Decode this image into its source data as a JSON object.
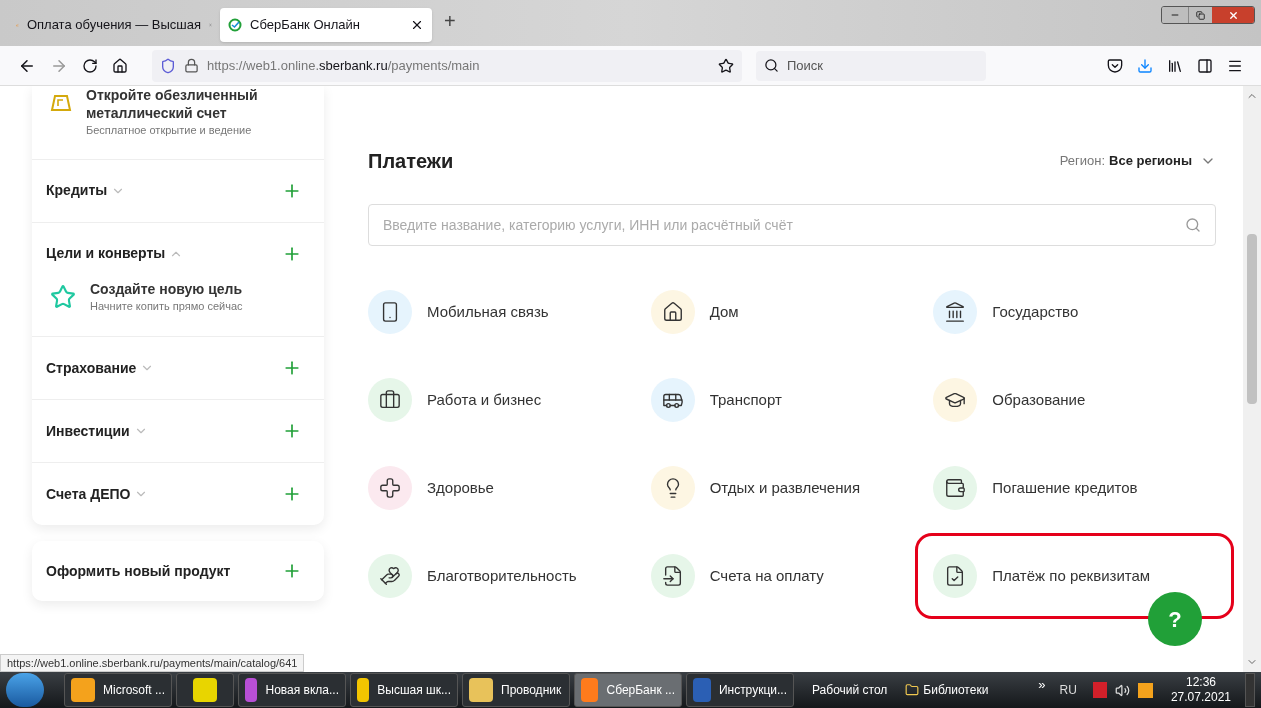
{
  "browser": {
    "tabs": [
      {
        "title": "Оплата обучения — Высшая",
        "selected": false
      },
      {
        "title": "СберБанк Онлайн",
        "selected": true
      }
    ],
    "new_tab": "+",
    "url": {
      "prefix": "https://web1.online.",
      "domain": "sberbank.ru",
      "path": "/payments/main"
    },
    "search": {
      "placeholder": "Поиск"
    },
    "status_url": "https://web1.online.sberbank.ru/payments/main/catalog/641"
  },
  "sidebar": {
    "promo": {
      "title": "Откройте обезличенный металлический счет",
      "subtitle": "Бесплатное открытие и ведение"
    },
    "sections": [
      {
        "label": "Кредиты",
        "expanded": false
      },
      {
        "label": "Цели и конверты",
        "expanded": true,
        "children": [
          {
            "title": "Создайте новую цель",
            "subtitle": "Начните копить прямо сейчас"
          }
        ]
      },
      {
        "label": "Страхование",
        "expanded": false
      },
      {
        "label": "Инвестиции",
        "expanded": false
      },
      {
        "label": "Счета ДЕПО",
        "expanded": false
      }
    ],
    "new_product": "Оформить новый продукт"
  },
  "payments": {
    "title": "Платежи",
    "region_label": "Регион:",
    "region_value": "Все регионы",
    "search": {
      "placeholder": "Введите название, категорию услуги, ИНН или расчётный счёт"
    },
    "categories": [
      {
        "label": "Мобильная связь",
        "color": "#e6f4fd",
        "highlighted": false
      },
      {
        "label": "Дом",
        "color": "#fdf6e3",
        "highlighted": false
      },
      {
        "label": "Государство",
        "color": "#e6f4fd",
        "highlighted": false
      },
      {
        "label": "Работа и бизнес",
        "color": "#e6f6e9",
        "highlighted": false
      },
      {
        "label": "Транспорт",
        "color": "#e6f4fd",
        "highlighted": false
      },
      {
        "label": "Образование",
        "color": "#fdf6e3",
        "highlighted": false
      },
      {
        "label": "Здоровье",
        "color": "#fbe9ef",
        "highlighted": false
      },
      {
        "label": "Отдых и развлечения",
        "color": "#fdf6e3",
        "highlighted": false
      },
      {
        "label": "Погашение кредитов",
        "color": "#e6f6e9",
        "highlighted": false
      },
      {
        "label": "Благотворительность",
        "color": "#e6f6e9",
        "highlighted": false
      },
      {
        "label": "Счета на оплату",
        "color": "#e6f6e9",
        "highlighted": false
      },
      {
        "label": "Платёж по реквизитам",
        "color": "#e6f6e9",
        "highlighted": true
      }
    ],
    "help": "?"
  },
  "taskbar": {
    "items": [
      {
        "label": "Microsoft ...",
        "selected": false
      },
      {
        "selected": false
      },
      {
        "label": "Новая вкла...",
        "selected": false
      },
      {
        "label": "Высшая шк...",
        "selected": false
      },
      {
        "label": "Проводник",
        "selected": false
      },
      {
        "label": "СберБанк ...",
        "selected": true
      },
      {
        "label": "Инструкци...",
        "selected": false
      }
    ],
    "toolbars": [
      "Рабочий стол",
      "Библиотеки"
    ],
    "overflow": "»",
    "language": "RU",
    "time": "12:36",
    "date": "27.07.2021"
  }
}
